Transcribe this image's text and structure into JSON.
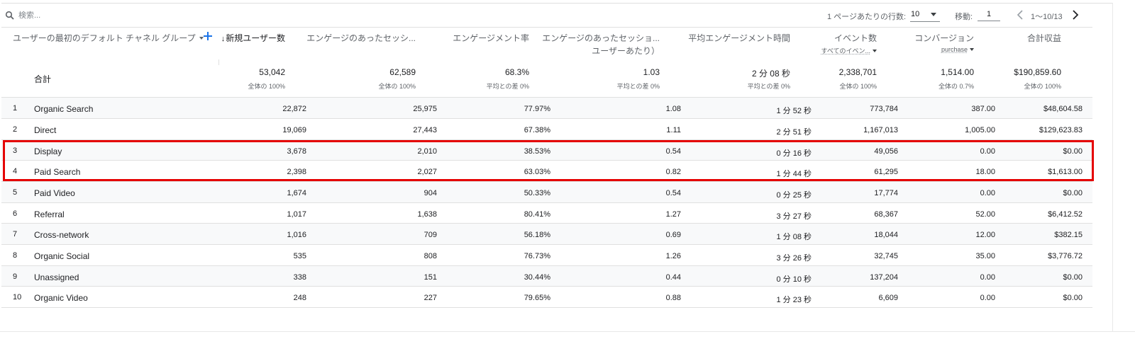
{
  "toolbar": {
    "search_placeholder": "検索...",
    "rows_per_page_label": "1 ページあたりの行数:",
    "rows_per_page_value": "10",
    "goto_label": "移動:",
    "goto_value": "1",
    "page_range": "1〜10/13"
  },
  "table": {
    "dimension_header": "ユーザーの最初のデフォルト チャネル グループ",
    "columns": [
      {
        "label": "新規ユーザー数",
        "sorted": true,
        "sub": ""
      },
      {
        "label": "エンゲージのあったセッシ...",
        "sub": ""
      },
      {
        "label": "エンゲージメント率",
        "sub": ""
      },
      {
        "label": "エンゲージのあったセッショ...",
        "label2": "ユーザーあたり）",
        "sub": ""
      },
      {
        "label": "平均エンゲージメント時間",
        "sub": ""
      },
      {
        "label": "イベント数",
        "sub": "すべてのイベン..."
      },
      {
        "label": "コンバージョン",
        "sub": "purchase"
      },
      {
        "label": "合計収益",
        "sub": ""
      }
    ],
    "totals": {
      "label": "合計",
      "values": [
        "53,042",
        "62,589",
        "68.3%",
        "1.03",
        "2 分 08 秒",
        "2,338,701",
        "1,514.00",
        "$190,859.60"
      ],
      "subs": [
        "全体の 100%",
        "全体の 100%",
        "平均との差 0%",
        "平均との差 0%",
        "平均との差 0%",
        "全体の 100%",
        "全体の 0.7%",
        "全体の 100%"
      ]
    },
    "rows": [
      {
        "num": "1",
        "name": "Organic Search",
        "values": [
          "22,872",
          "25,975",
          "77.97%",
          "1.08",
          "1 分 52 秒",
          "773,784",
          "387.00",
          "$48,604.58"
        ]
      },
      {
        "num": "2",
        "name": "Direct",
        "values": [
          "19,069",
          "27,443",
          "67.38%",
          "1.11",
          "2 分 51 秒",
          "1,167,013",
          "1,005.00",
          "$129,623.83"
        ]
      },
      {
        "num": "3",
        "name": "Display",
        "values": [
          "3,678",
          "2,010",
          "38.53%",
          "0.54",
          "0 分 16 秒",
          "49,056",
          "0.00",
          "$0.00"
        ]
      },
      {
        "num": "4",
        "name": "Paid Search",
        "values": [
          "2,398",
          "2,027",
          "63.03%",
          "0.82",
          "1 分 44 秒",
          "61,295",
          "18.00",
          "$1,613.00"
        ]
      },
      {
        "num": "5",
        "name": "Paid Video",
        "values": [
          "1,674",
          "904",
          "50.33%",
          "0.54",
          "0 分 25 秒",
          "17,774",
          "0.00",
          "$0.00"
        ]
      },
      {
        "num": "6",
        "name": "Referral",
        "values": [
          "1,017",
          "1,638",
          "80.41%",
          "1.27",
          "3 分 27 秒",
          "68,367",
          "52.00",
          "$6,412.52"
        ]
      },
      {
        "num": "7",
        "name": "Cross-network",
        "values": [
          "1,016",
          "709",
          "56.18%",
          "0.69",
          "1 分 08 秒",
          "18,044",
          "12.00",
          "$382.15"
        ]
      },
      {
        "num": "8",
        "name": "Organic Social",
        "values": [
          "535",
          "808",
          "76.73%",
          "1.26",
          "3 分 26 秒",
          "32,745",
          "35.00",
          "$3,776.72"
        ]
      },
      {
        "num": "9",
        "name": "Unassigned",
        "values": [
          "338",
          "151",
          "30.44%",
          "0.44",
          "0 分 10 秒",
          "137,204",
          "0.00",
          "$0.00"
        ]
      },
      {
        "num": "10",
        "name": "Organic Video",
        "values": [
          "248",
          "227",
          "79.65%",
          "0.88",
          "1 分 23 秒",
          "6,609",
          "0.00",
          "$0.00"
        ]
      }
    ]
  },
  "colors": {
    "highlight": "#e50000",
    "accent": "#1a73e8"
  }
}
